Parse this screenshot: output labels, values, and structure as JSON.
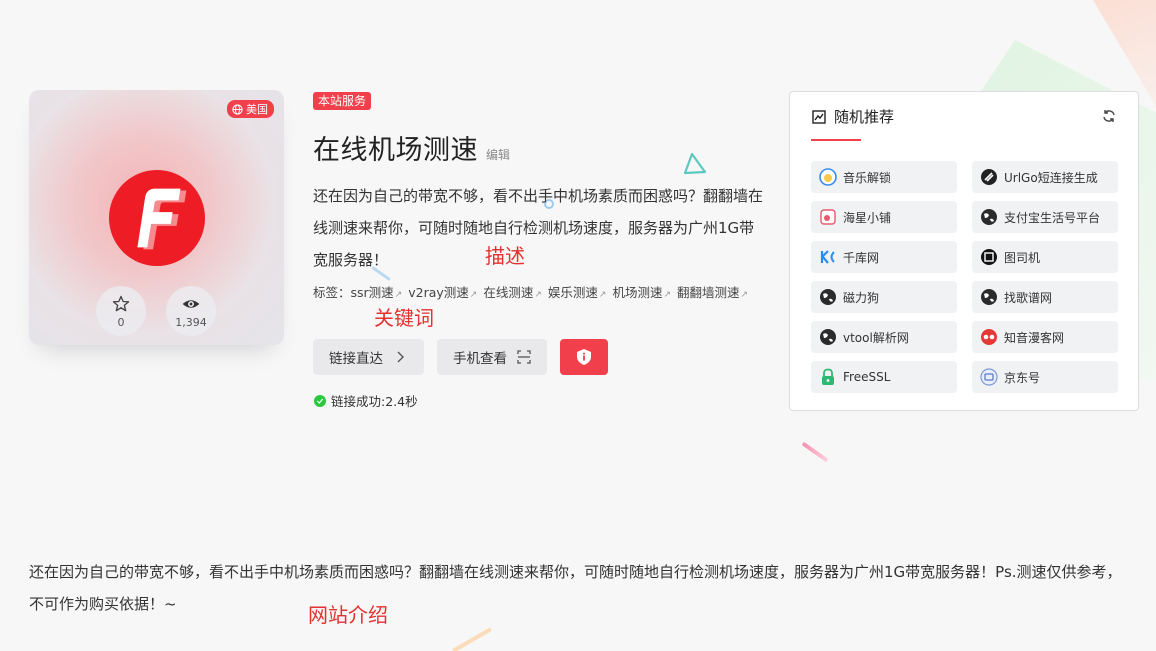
{
  "logo_card": {
    "country": "美国",
    "favorites": "0",
    "views": "1,394",
    "brand_color": "#f1404b"
  },
  "service_tag": "本站服务",
  "title": "在线机场测速",
  "edit_label": "编辑",
  "description": "还在因为自己的带宽不够，看不出手中机场素质而困惑吗？翻翻墙在线测速来帮你，可随时随地自行检测机场速度，服务器为广州1G带宽服务器！",
  "tags_label": "标签：",
  "tags": [
    "ssr测速",
    "v2ray测速",
    "在线测速",
    "娱乐测速",
    "机场测速",
    "翻翻墙测速"
  ],
  "buttons": {
    "go": "链接直达",
    "phone": "手机查看"
  },
  "status": "链接成功:2.4秒",
  "annotations": {
    "desc": "描述",
    "keywords": "关键词",
    "intro": "网站介绍"
  },
  "panel": {
    "title": "随机推荐",
    "items": [
      {
        "label": "音乐解锁",
        "icon": "music-unlock-icon"
      },
      {
        "label": "UrlGo短连接生成",
        "icon": "urlgo-icon"
      },
      {
        "label": "海星小铺",
        "icon": "starfish-icon"
      },
      {
        "label": "支付宝生活号平台",
        "icon": "globe-icon"
      },
      {
        "label": "千库网",
        "icon": "qianku-icon"
      },
      {
        "label": "图司机",
        "icon": "tusiji-icon"
      },
      {
        "label": "磁力狗",
        "icon": "globe-icon"
      },
      {
        "label": "找歌谱网",
        "icon": "globe-icon"
      },
      {
        "label": "vtool解析网",
        "icon": "globe-icon"
      },
      {
        "label": "知音漫客网",
        "icon": "zhiyin-icon"
      },
      {
        "label": "FreeSSL",
        "icon": "lock-icon"
      },
      {
        "label": "京东号",
        "icon": "jd-icon"
      }
    ]
  },
  "intro": "还在因为自己的带宽不够，看不出手中机场素质而困惑吗？翻翻墙在线测速来帮你，可随时随地自行检测机场速度，服务器为广州1G带宽服务器！Ps.测速仅供参考，不可作为购买依据！~"
}
